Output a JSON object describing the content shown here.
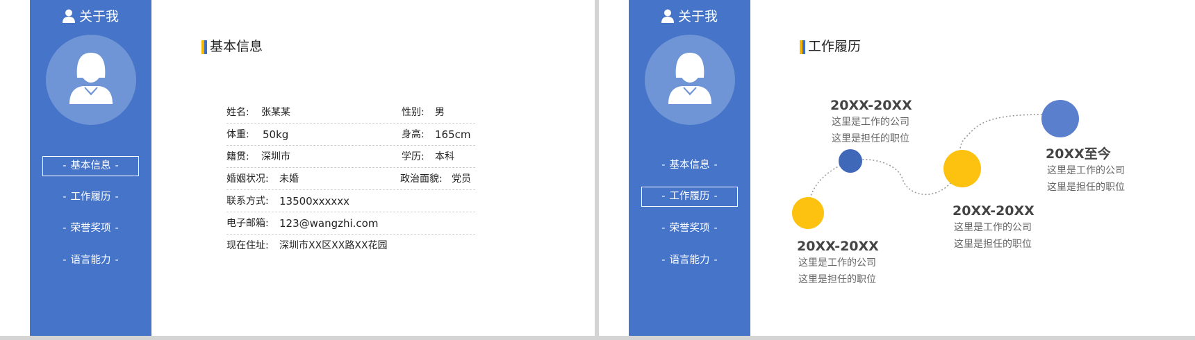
{
  "colors": {
    "sidebar": "#4574c8",
    "avatar_circle": "#6f95d6",
    "yellow": "#fcc20f",
    "blue_dot": "#3f68b8",
    "blue_dot_large": "#5a7fcc",
    "accent_bar_yellow": "#f6b600",
    "accent_bar_blue": "#3f6fc0"
  },
  "left_slide": {
    "sidebar": {
      "title": "关于我",
      "title_icon": "person-icon",
      "avatar_icon": "female-avatar-icon",
      "nav": [
        {
          "label": "基本信息",
          "active": true
        },
        {
          "label": "工作履历",
          "active": false
        },
        {
          "label": "荣誉奖项",
          "active": false
        },
        {
          "label": "语言能力",
          "active": false
        }
      ],
      "dash": "-"
    },
    "section_title": "基本信息",
    "info": [
      {
        "label": "姓名:",
        "value": "张某某",
        "label2": "性别:",
        "value2": "男"
      },
      {
        "label": "体重:",
        "value": "50kg",
        "label2": "身高:",
        "value2": "165cm"
      },
      {
        "label": "籍贯:",
        "value": "深圳市",
        "label2": "学历:",
        "value2": "本科"
      },
      {
        "label": "婚姻状况:",
        "value": "未婚",
        "label2": "政治面貌:",
        "value2": "党员"
      },
      {
        "label": "联系方式:",
        "value": "13500xxxxxx"
      },
      {
        "label": "电子邮箱:",
        "value": "123@wangzhi.com"
      },
      {
        "label": "现在住址:",
        "value": "深圳市XX区XX路XX花园"
      }
    ]
  },
  "right_slide": {
    "sidebar": {
      "title": "关于我",
      "title_icon": "person-icon",
      "avatar_icon": "female-avatar-icon",
      "nav": [
        {
          "label": "基本信息",
          "active": false
        },
        {
          "label": "工作履历",
          "active": true
        },
        {
          "label": "荣誉奖项",
          "active": false
        },
        {
          "label": "语言能力",
          "active": false
        }
      ],
      "dash": "-"
    },
    "section_title": "工作履历",
    "timeline": [
      {
        "year": "20XX-20XX",
        "company": "这里是工作的公司",
        "position": "这里是担任的职位"
      },
      {
        "year": "20XX-20XX",
        "company": "这里是工作的公司",
        "position": "这里是担任的职位"
      },
      {
        "year": "20XX-20XX",
        "company": "这里是工作的公司",
        "position": "这里是担任的职位"
      },
      {
        "year": "20XX至今",
        "company": "这里是工作的公司",
        "position": "这里是担任的职位"
      }
    ]
  }
}
